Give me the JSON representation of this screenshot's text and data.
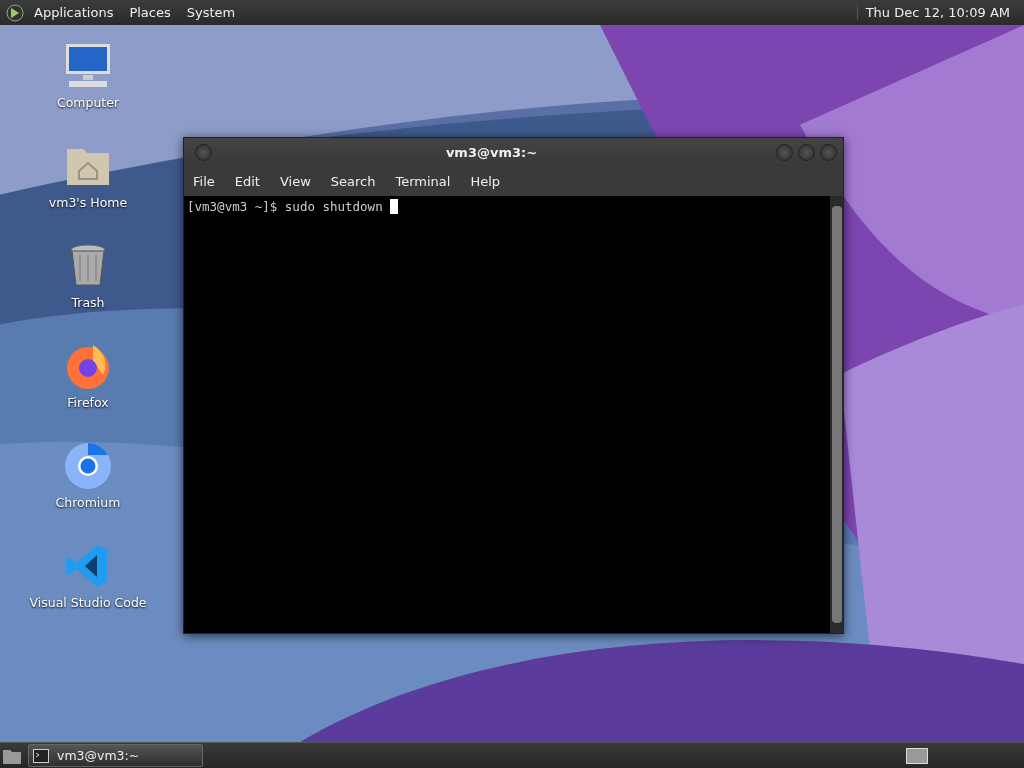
{
  "top_panel": {
    "menus": [
      "Applications",
      "Places",
      "System"
    ],
    "clock": "Thu Dec 12, 10:09 AM"
  },
  "desktop_icons": [
    {
      "label": "Computer",
      "kind": "computer"
    },
    {
      "label": "vm3's Home",
      "kind": "home"
    },
    {
      "label": "Trash",
      "kind": "trash"
    },
    {
      "label": "Firefox",
      "kind": "firefox"
    },
    {
      "label": "Chromium",
      "kind": "chromium"
    },
    {
      "label": "Visual Studio Code",
      "kind": "vscode"
    }
  ],
  "terminal": {
    "title": "vm3@vm3:~",
    "menus": [
      "File",
      "Edit",
      "View",
      "Search",
      "Terminal",
      "Help"
    ],
    "prompt": "[vm3@vm3 ~]$ sudo shutdown "
  },
  "taskbar": {
    "tasks": [
      {
        "label": "vm3@vm3:~",
        "selected": true
      }
    ]
  }
}
